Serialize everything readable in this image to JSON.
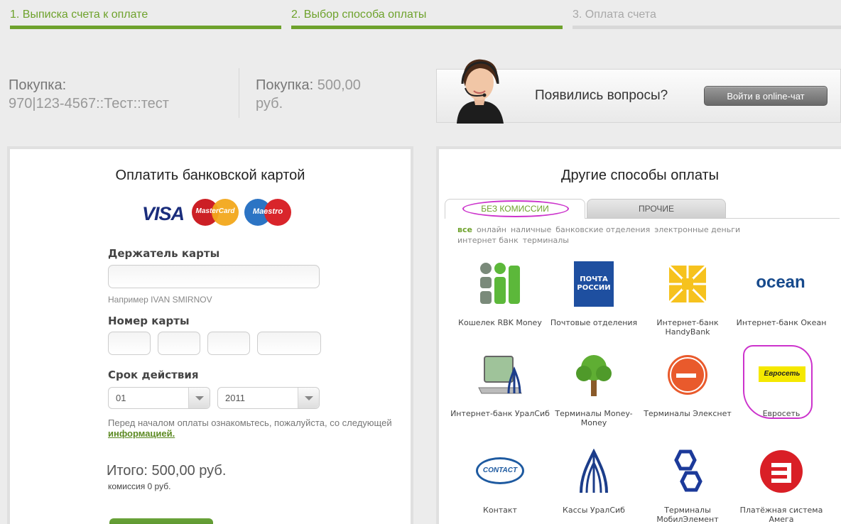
{
  "steps": [
    {
      "label": "1. Выписка счета к оплате",
      "state": "active"
    },
    {
      "label": "2. Выбор способа оплаты",
      "state": "active"
    },
    {
      "label": "3. Оплата счета",
      "state": "inactive"
    }
  ],
  "purchase": {
    "left_label": "Покупка:",
    "left_value": "970|123-4567::Тест::тест",
    "right_label": "Покупка:",
    "right_amount": "500,00",
    "right_currency": "руб."
  },
  "help": {
    "question": "Появились вопросы?",
    "chat_button": "Войти в online-чат"
  },
  "card_panel": {
    "title": "Оплатить банковской картой",
    "logos": {
      "visa": "VISA",
      "mastercard": "MasterCard",
      "maestro": "Maestro"
    },
    "holder_label": "Держатель карты",
    "holder_hint": "Например IVAN SMIRNOV",
    "number_label": "Номер карты",
    "expiry_label": "Срок действия",
    "month_value": "01",
    "year_value": "2011",
    "note_text": "Перед началом оплаты ознакомьтесь, пожалуйста, со следующей ",
    "note_link": "информацией.",
    "total": "Итого: 500,00 руб.",
    "commission": "комиссия 0 руб."
  },
  "other_panel": {
    "title": "Другие способы оплаты",
    "tabs": {
      "free": "БЕЗ КОМИССИИ",
      "other": "ПРОЧИЕ"
    },
    "filters": [
      "все",
      "онлайн",
      "наличные",
      "банковские отделения",
      "электронные деньги",
      "интернет банк",
      "терминалы"
    ],
    "methods": [
      {
        "name": "Кошелек RBK Money"
      },
      {
        "name": "Почтовые отделения",
        "logo_text_1": "ПОЧТА",
        "logo_text_2": "РОССИИ"
      },
      {
        "name": "Интернет-банк HandyBank"
      },
      {
        "name": "Интернет-банк Океан",
        "logo_text": "ocean"
      },
      {
        "name": "Интернет-банк УралСиб"
      },
      {
        "name": "Терминалы Money-Money"
      },
      {
        "name": "Терминалы Элекснет"
      },
      {
        "name": "Евросеть",
        "logo_text": "Евросеть"
      },
      {
        "name": "Контакт",
        "logo_text": "CONTACT"
      },
      {
        "name": "Кассы УралСиб"
      },
      {
        "name": "Терминалы МобилЭлемент"
      },
      {
        "name": "Платёжная система Амега"
      }
    ]
  },
  "colors": {
    "accent": "#6ea22c",
    "highlight": "#cc33cc",
    "chat_button": "#7a7a7a"
  }
}
